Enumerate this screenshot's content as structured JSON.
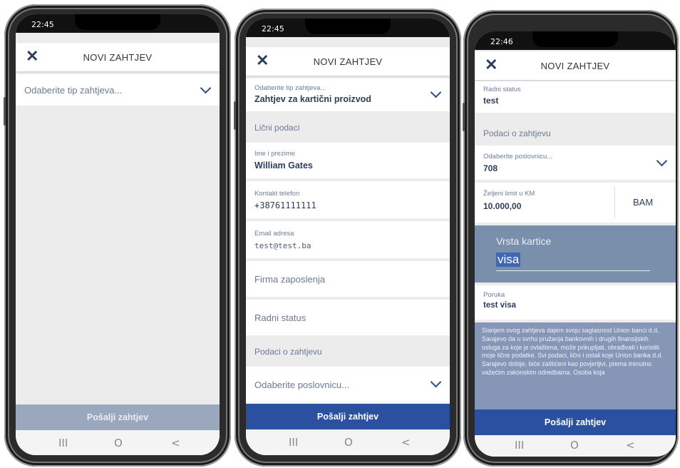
{
  "colors": {
    "accent": "#2c4d80",
    "submit_active": "#2c50a0",
    "submit_disabled": "#9aa7bd",
    "overlay": "#7a8fac",
    "legal_bg": "#8596b6"
  },
  "phone1": {
    "time": "22:45",
    "title": "NOVI ZAHTJEV",
    "select_placeholder": "Odaberite tip zahtjeva...",
    "submit": "Pošalji zahtjev",
    "nav": {
      "recent": "III",
      "home": "O",
      "back": "<"
    }
  },
  "phone2": {
    "time": "22:45",
    "title": "NOVI ZAHTJEV",
    "type_label": "Odaberite tip zahtjeva...",
    "type_value": "Zahtjev za kartični proizvod",
    "section_personal": "Lični podaci",
    "name_label": "Ime i prezime",
    "name_value": "William Gates",
    "phone_label": "Kontakt telefon",
    "phone_value": "+38761111111",
    "email_label": "Email adresa",
    "email_value": "test@test.ba",
    "employer_placeholder": "Firma zaposlenja",
    "work_status_placeholder": "Radni status",
    "section_request": "Podaci o zahtjevu",
    "branch_placeholder": "Odaberite poslovnicu...",
    "submit": "Pošalji zahtjev",
    "nav": {
      "recent": "III",
      "home": "O",
      "back": "<"
    }
  },
  "phone3": {
    "time": "22:46",
    "title": "NOVI ZAHTJEV",
    "work_status_label": "Radni status",
    "work_status_value": "test",
    "section_request": "Podaci o zahtjevu",
    "branch_label": "Odaberite poslovnicu...",
    "branch_value": "708",
    "limit_label": "Željeni limit u KM",
    "limit_value": "10.000,00",
    "currency": "BAM",
    "card_type_label": "Vrsta kartice",
    "card_type_value": "visa",
    "message_label": "Poruka",
    "message_value": "test visa",
    "legal_text": "Slanjem ovog zahtjeva dajem svoju saglasnost Union banci d.d. Sarajevo da u svrhu pružanja bankovnih i drugih finansijskih usluga za koje je ovlaštena, može prikupljati, obrađivati i koristiti moje lične podatke. Svi podaci, lični i ostali koje Union banka d.d. Sarajevo dobije, biće zaštićeni kao povjerljivi, prema trenutno važećim zakonskim odredbama. Osoba koja",
    "submit": "Pošalji zahtjev",
    "nav": {
      "recent": "III",
      "home": "O",
      "back": "<"
    }
  }
}
